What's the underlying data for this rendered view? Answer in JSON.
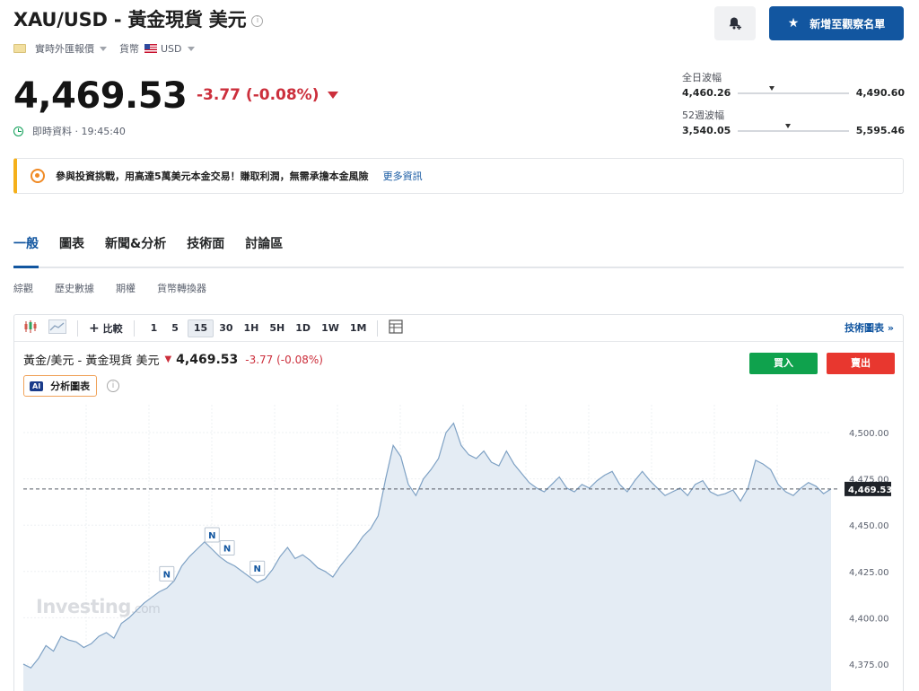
{
  "header": {
    "title": "XAU/USD - 黃金現貨 美元",
    "info_icon": "info-circle-icon",
    "source_label": "實時外匯報價",
    "currency_label": "貨幣",
    "currency_value": "USD",
    "bell_icon": "bell-plus-icon",
    "watchlist_label": "新增至觀察名單"
  },
  "quote": {
    "price": "4,469.53",
    "change": "-3.77 (-0.08%)",
    "realtime_label": "即時資料 · 19:45:40",
    "down_color": "#cc2f3c",
    "accent_color": "#1256a0"
  },
  "ranges": {
    "day": {
      "label": "全日波幅",
      "low": "4,460.26",
      "high": "4,490.60",
      "position": 0.31
    },
    "week52": {
      "label": "52週波幅",
      "low": "3,540.05",
      "high": "5,595.46",
      "position": 0.45
    }
  },
  "banner": {
    "text": "參與投資挑戰，用高達5萬美元本金交易！賺取利潤，無需承擔本金風險",
    "link": "更多資訊"
  },
  "tabs": [
    "一般",
    "圖表",
    "新聞&分析",
    "技術面",
    "討論區"
  ],
  "subtabs": [
    "綜觀",
    "歷史數據",
    "期權",
    "貨幣轉換器"
  ],
  "toolbar": {
    "compare_label": "比較",
    "intervals": [
      "1",
      "5",
      "15",
      "30",
      "1H",
      "5H",
      "1D",
      "1W",
      "1M"
    ],
    "selected_interval": "15",
    "tech_chart_label": "技術圖表 »"
  },
  "chart_header": {
    "name": "黃金/美元 - 黃金現貨 美元",
    "price": "4,469.53",
    "change": "-3.77 (-0.08%)",
    "ai_badge": "AI",
    "ai_label": "分析圖表",
    "buy_label": "買入",
    "sell_label": "賣出",
    "watermark": "Investing",
    "watermark_suffix": ".com"
  },
  "chart_data": {
    "type": "area",
    "ylim": [
      4360,
      4515
    ],
    "y_ticks": [
      4375,
      4400,
      4425,
      4450,
      4475,
      4500
    ],
    "y_tick_labels": [
      "4,375.00",
      "4,400.00",
      "4,425.00",
      "4,450.00",
      "4,475.00",
      "4,500.00"
    ],
    "last_value": 4469.53,
    "last_label": "4,469.53",
    "news_marker_label": "N",
    "news_marker_indices": [
      19,
      25,
      27,
      31
    ],
    "values": [
      4375,
      4373,
      4378,
      4385,
      4382,
      4390,
      4388,
      4387,
      4384,
      4386,
      4390,
      4392,
      4389,
      4397,
      4400,
      4404,
      4408,
      4411,
      4414,
      4416,
      4420,
      4428,
      4433,
      4437,
      4441,
      4437,
      4433,
      4430,
      4428,
      4425,
      4422,
      4419,
      4421,
      4426,
      4433,
      4438,
      4432,
      4434,
      4431,
      4427,
      4425,
      4422,
      4428,
      4433,
      4438,
      4444,
      4448,
      4455,
      4475,
      4493,
      4487,
      4472,
      4466,
      4475,
      4480,
      4486,
      4500,
      4505,
      4493,
      4488,
      4486,
      4490,
      4484,
      4482,
      4490,
      4483,
      4478,
      4473,
      4470,
      4468,
      4472,
      4476,
      4470,
      4468,
      4472,
      4470,
      4474,
      4477,
      4479,
      4472,
      4468,
      4474,
      4479,
      4474,
      4470,
      4466,
      4468,
      4470,
      4466,
      4472,
      4474,
      4468,
      4466,
      4467,
      4469,
      4463,
      4470,
      4485,
      4483,
      4480,
      4472,
      4468,
      4466,
      4470,
      4473,
      4471,
      4467,
      4469.53
    ]
  }
}
